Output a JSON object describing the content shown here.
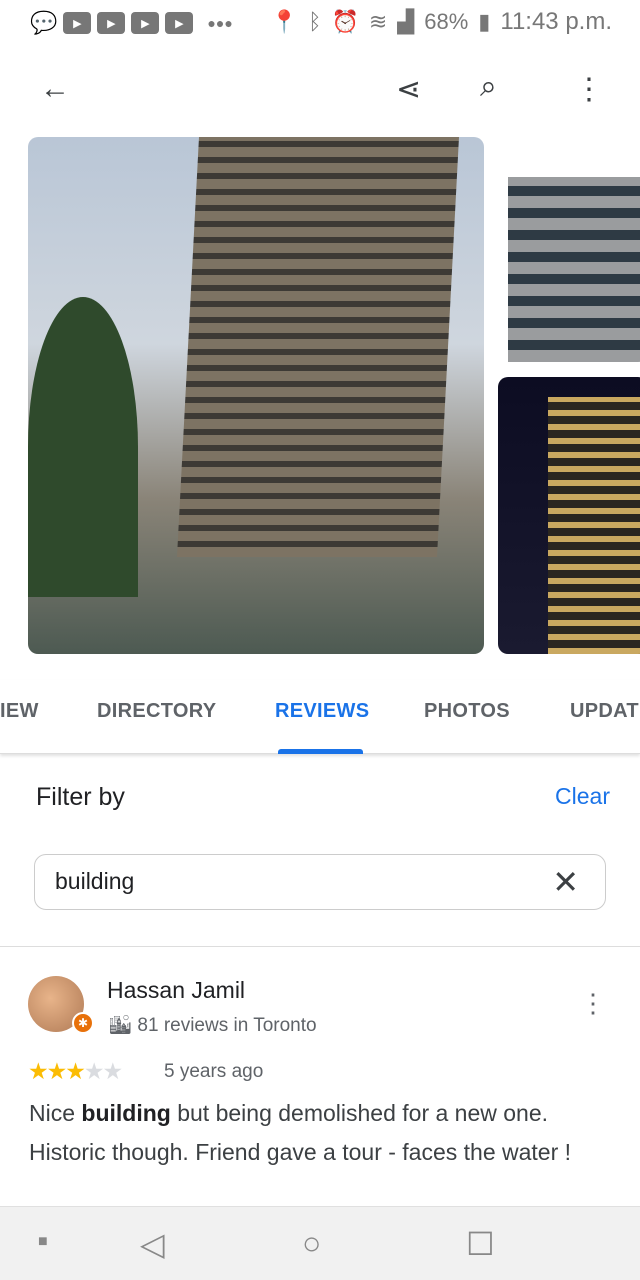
{
  "status": {
    "battery": "68%",
    "time": "11:43 p.m.",
    "icons": [
      "messages-icon",
      "youtube-icon",
      "youtube-icon",
      "youtube-icon",
      "youtube-icon",
      "more-notifications-icon",
      "location-icon",
      "bluetooth-icon",
      "alarm-icon",
      "wifi-icon",
      "signal-icon",
      "battery-charging-icon"
    ]
  },
  "topbar": {
    "icons": [
      "back-arrow-icon",
      "share-icon",
      "search-icon",
      "more-vert-icon"
    ]
  },
  "tabs": [
    {
      "label": "IEW"
    },
    {
      "label": "DIRECTORY"
    },
    {
      "label": "REVIEWS",
      "active": true
    },
    {
      "label": "PHOTOS"
    },
    {
      "label": "UPDAT"
    }
  ],
  "filter": {
    "title": "Filter by",
    "clear_label": "Clear",
    "search_value": "building"
  },
  "review": {
    "author": "Hassan Jamil",
    "meta": "81 reviews in Toronto",
    "rating": 3,
    "max_rating": 5,
    "time": "5 years ago",
    "text_before": "Nice ",
    "highlight": "building",
    "text_after": " but being demolished for a new one. Historic though. Friend gave a tour - faces the water !"
  },
  "colors": {
    "accent": "#1a73e8",
    "star": "#fbbc04",
    "star_empty": "#dadce0"
  }
}
